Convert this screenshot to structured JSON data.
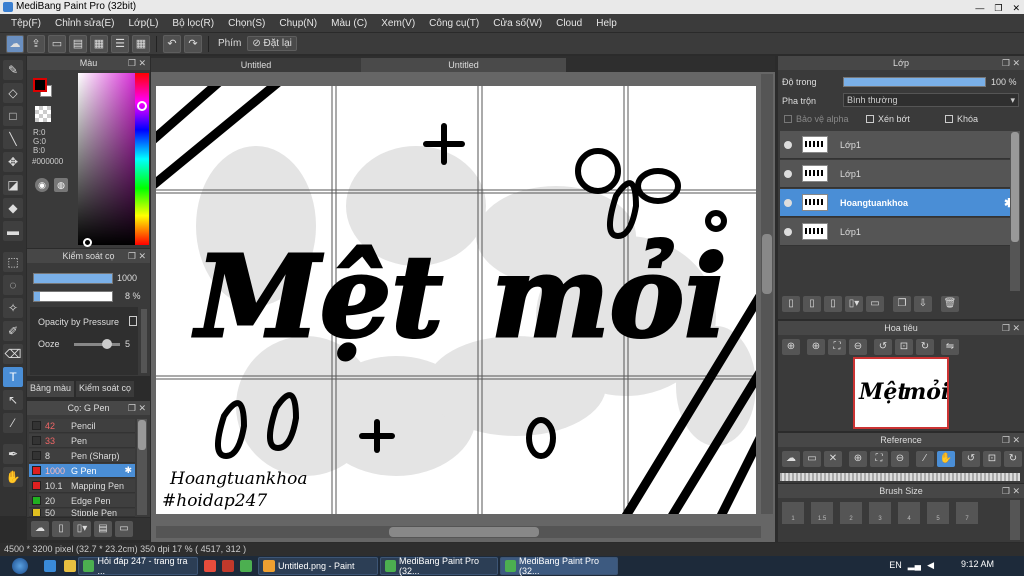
{
  "window": {
    "title": "MediBang Paint Pro (32bit)",
    "controls": [
      "—",
      "❐",
      "✕"
    ]
  },
  "menu": [
    "Tệp(F)",
    "Chỉnh sửa(E)",
    "Lớp(L)",
    "Bộ lọc(R)",
    "Chọn(S)",
    "Chụp(N)",
    "Màu (C)",
    "Xem(V)",
    "Công cụ(T)",
    "Cửa số(W)",
    "Cloud",
    "Help"
  ],
  "toolbar": {
    "shortcut_label": "Phím",
    "reset_label": "Đặt lại"
  },
  "color_panel": {
    "title": "Màu",
    "r": "R:0",
    "g": "G:0",
    "b": "B:0",
    "hex": "#000000",
    "fg_color": "#000000"
  },
  "brush_control": {
    "title": "Kiểm soát cọ",
    "size_value": "1000",
    "size_fill": 1.0,
    "opacity_value": "8 %",
    "opacity_fill": 0.08,
    "opacity_pressure_label": "Opacity by Pressure",
    "ooze_label": "Ooze",
    "ooze_value": "5",
    "ooze_fill": 0.7
  },
  "side_tabs": [
    "Bảng màu",
    "Kiểm soát cọ"
  ],
  "brush_list": {
    "title": "Cọ: G Pen",
    "items": [
      {
        "size": "42",
        "name": "Pencil",
        "color": "#333333"
      },
      {
        "size": "33",
        "name": "Pen",
        "color": "#333333"
      },
      {
        "size": "8",
        "name": "Pen (Sharp)",
        "color": "#333333"
      },
      {
        "size": "1000",
        "name": "G Pen",
        "color": "#e02020"
      },
      {
        "size": "10.1",
        "name": "Mapping Pen",
        "color": "#e02020"
      },
      {
        "size": "20",
        "name": "Edge Pen",
        "color": "#20b020"
      },
      {
        "size": "50",
        "name": "Stipple Pen",
        "color": "#e0c020"
      }
    ]
  },
  "canvas": {
    "tabs": [
      "Untitled",
      "Untitled"
    ],
    "text_main_1": "Mệt",
    "text_main_2": "mỏi",
    "signature_1": "Hoangtuankhoa",
    "signature_2": "#hoidap247"
  },
  "layer_panel": {
    "title": "Lớp",
    "opacity_label": "Độ trong",
    "opacity_value": "100 %",
    "opacity_fill": 1.0,
    "blend_label": "Pha trộn",
    "blend_value": "Bình thường",
    "protect_alpha": "Bảo vệ alpha",
    "clipping": "Xén bớt",
    "lock": "Khóa",
    "layers": [
      {
        "name": "Lớp1",
        "selected": false
      },
      {
        "name": "Lớp1",
        "selected": false
      },
      {
        "name": "Hoangtuankhoa",
        "selected": true
      },
      {
        "name": "Lớp1",
        "selected": false
      }
    ]
  },
  "navigator": {
    "title": "Hoa tiêu"
  },
  "reference": {
    "title": "Reference"
  },
  "brush_size": {
    "title": "Brush Size",
    "sizes": [
      "1",
      "1.5",
      "2",
      "3",
      "4",
      "5",
      "7"
    ]
  },
  "status": {
    "text": "4500 * 3200 pixel  (32.7 * 23.2cm)  350 dpi  17 %  ( 4517, 312 )"
  },
  "taskbar": {
    "items": [
      {
        "label": "Hỏi đáp 247 - trang tra ..."
      },
      {
        "label": "Untitled.png - Paint"
      },
      {
        "label": "MediBang Paint Pro (32..."
      },
      {
        "label": "MediBang Paint Pro (32..."
      }
    ],
    "lang": "EN",
    "time": "9:12 AM"
  }
}
